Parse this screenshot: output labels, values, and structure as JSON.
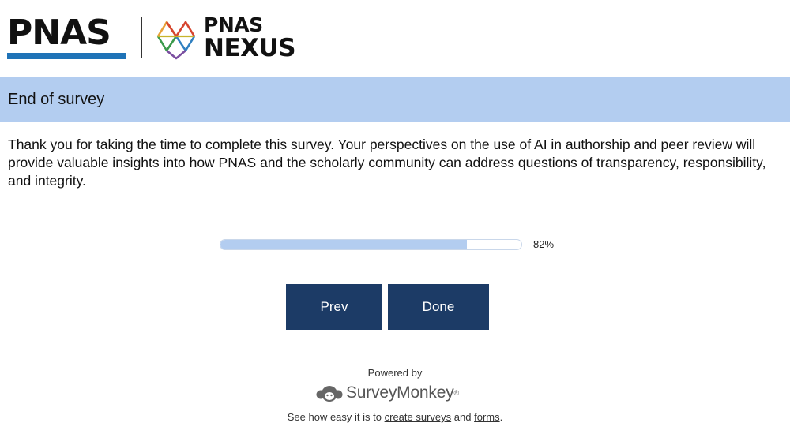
{
  "header": {
    "pnas_logo": "PNAS",
    "nexus_logo_top": "PNAS",
    "nexus_logo_bottom": "NEXUS",
    "brand_blue": "#1f73b7"
  },
  "banner": {
    "title": "End of survey",
    "background": "#b3cdf0"
  },
  "main": {
    "message": "Thank you for taking the time to complete this survey. Your perspectives on the use of AI in authorship and peer review will provide valuable insights into how PNAS and the scholarly community can address questions of transparency, responsibility, and integrity."
  },
  "progress": {
    "value": 0.82,
    "label": "82%"
  },
  "buttons": {
    "prev_label": "Prev",
    "done_label": "Done",
    "color": "#1c3b66"
  },
  "footer": {
    "powered_by": "Powered by",
    "brand": "SurveyMonkey",
    "see_prefix": "See how easy it is to",
    "link_surveys": "create surveys",
    "and": "and",
    "link_forms": "forms",
    "period": "."
  }
}
